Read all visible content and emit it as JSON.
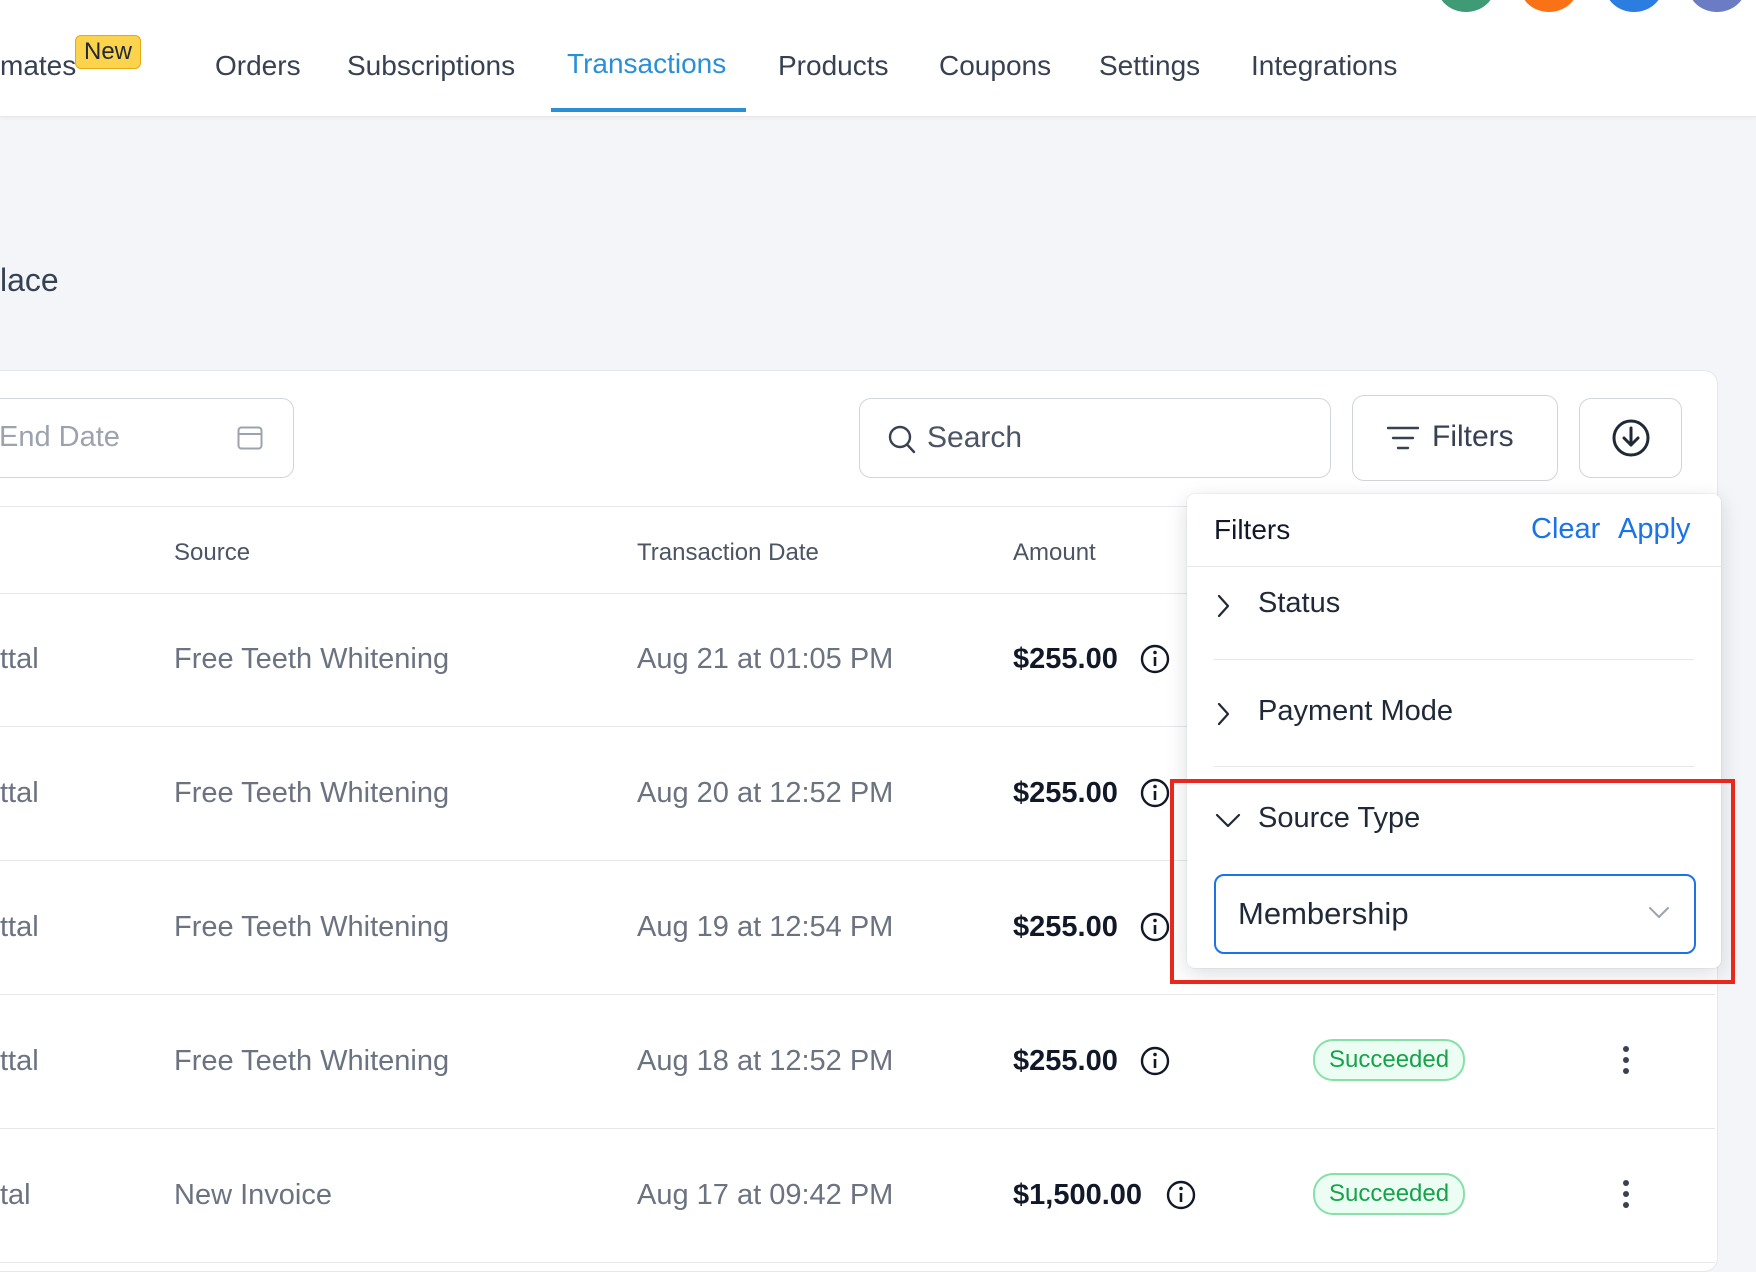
{
  "nav": {
    "tabs": [
      {
        "label": "mates"
      },
      {
        "label": "Orders"
      },
      {
        "label": "Subscriptions"
      },
      {
        "label": "Transactions"
      },
      {
        "label": "Products"
      },
      {
        "label": "Coupons"
      },
      {
        "label": "Settings"
      },
      {
        "label": "Integrations"
      }
    ],
    "new_badge": "New",
    "active_tab": "Transactions",
    "avatar_colors": [
      "#3f9a76",
      "#f97316",
      "#2b7de0",
      "#6b7bc4"
    ]
  },
  "page": {
    "title_fragment": "lace"
  },
  "toolbar": {
    "end_date_placeholder": "End Date",
    "search_placeholder": "Search",
    "filters_label": "Filters"
  },
  "table": {
    "headers": {
      "source": "Source",
      "transaction_date": "Transaction Date",
      "amount": "Amount"
    },
    "rows": [
      {
        "name": "ttal",
        "source": "Free Teeth Whitening",
        "date": "Aug 21 at 01:05 PM",
        "amount": "$255.00",
        "status": ""
      },
      {
        "name": "ttal",
        "source": "Free Teeth Whitening",
        "date": "Aug 20 at 12:52 PM",
        "amount": "$255.00",
        "status": ""
      },
      {
        "name": "ttal",
        "source": "Free Teeth Whitening",
        "date": "Aug 19 at 12:54 PM",
        "amount": "$255.00",
        "status": ""
      },
      {
        "name": "ttal",
        "source": "Free Teeth Whitening",
        "date": "Aug 18 at 12:52 PM",
        "amount": "$255.00",
        "status": "Succeeded"
      },
      {
        "name": "tal",
        "source": "New Invoice",
        "date": "Aug 17 at 09:42 PM",
        "amount": "$1,500.00",
        "status": "Succeeded"
      }
    ]
  },
  "filters_panel": {
    "title": "Filters",
    "clear_label": "Clear",
    "apply_label": "Apply",
    "sections": [
      {
        "label": "Status",
        "expanded": false
      },
      {
        "label": "Payment Mode",
        "expanded": false
      },
      {
        "label": "Source Type",
        "expanded": true
      }
    ],
    "source_type_value": "Membership"
  },
  "colors": {
    "accent": "#2b8fd6",
    "link": "#1a73e8",
    "success": "#16a34a",
    "highlight": "#e8281d"
  }
}
